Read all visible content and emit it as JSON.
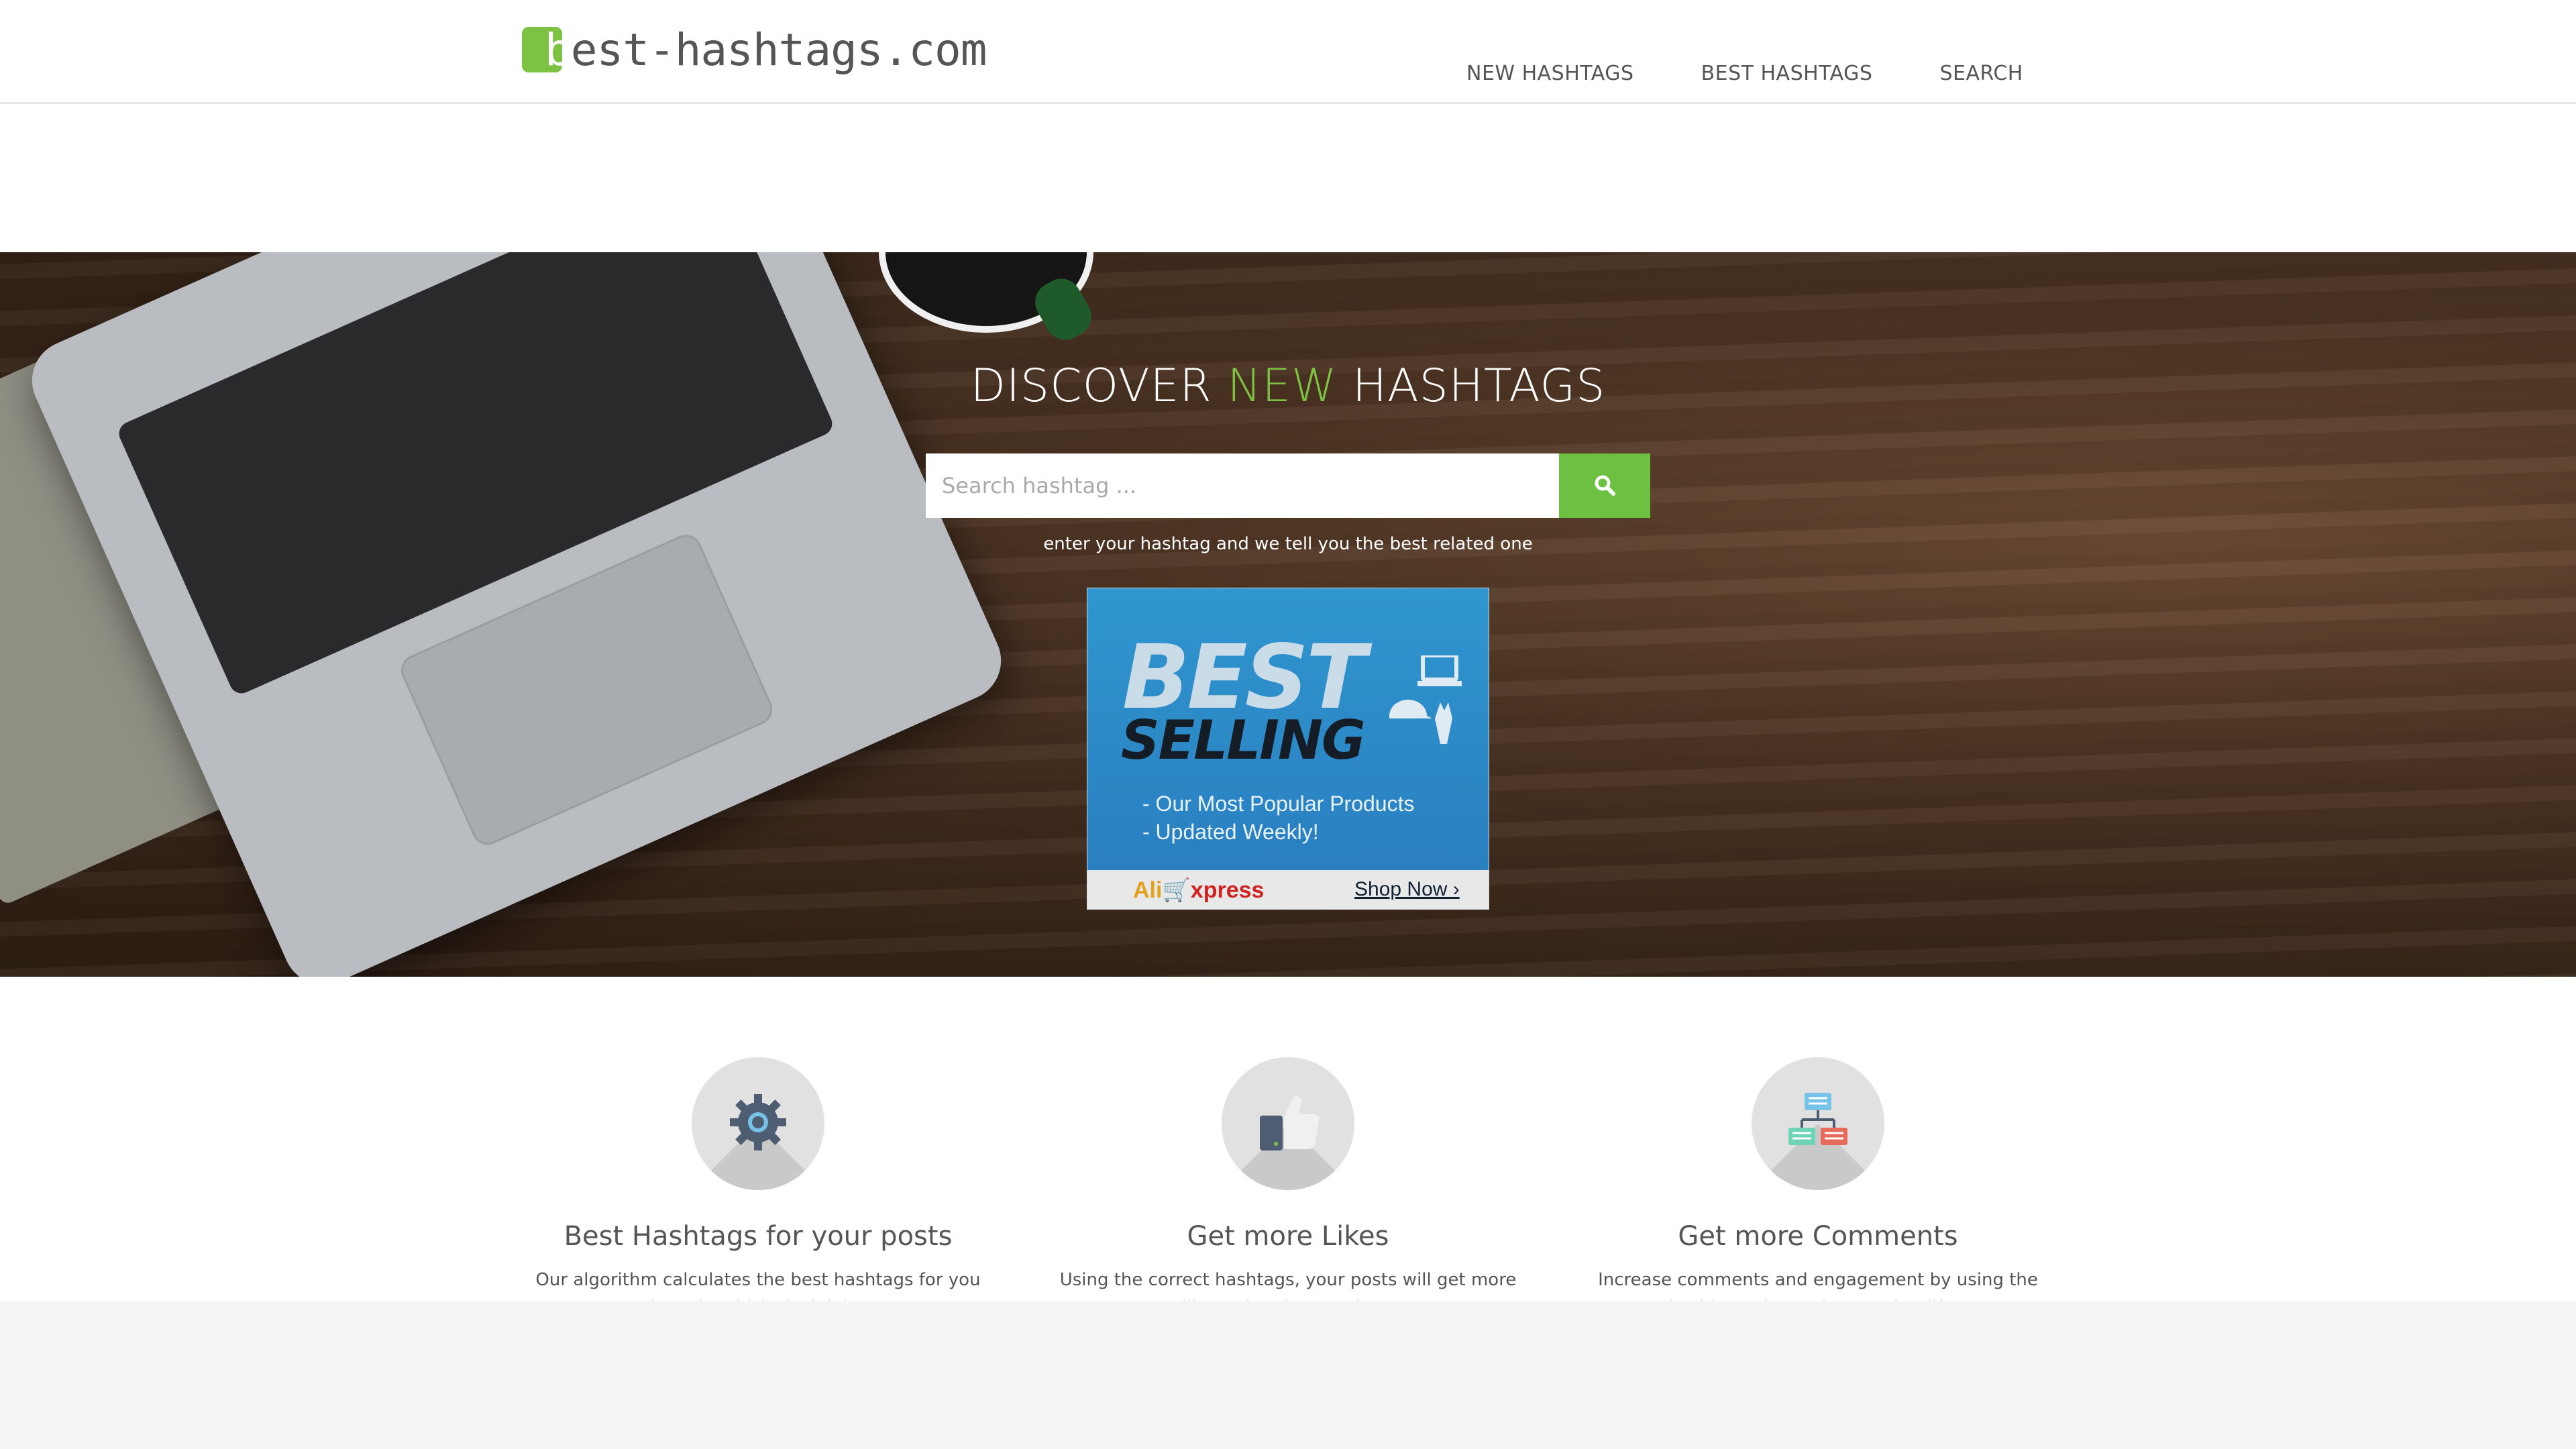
{
  "header": {
    "logo_text": "est-hashtags.com",
    "logo_letter": "b",
    "nav": [
      "NEW HASHTAGS",
      "BEST HASHTAGS",
      "SEARCH"
    ]
  },
  "hero": {
    "title_pre": "DISCOVER ",
    "title_accent": "NEW",
    "title_post": " HASHTAGS",
    "search_placeholder": "Search hashtag ...",
    "subtitle": "enter your hashtag and we tell you the best related one"
  },
  "ad": {
    "line1": "BEST",
    "line2": "SELLING",
    "bullet1": "- Our Most Popular Products",
    "bullet2": "- Updated Weekly!",
    "brand_a": "Ali",
    "brand_b": "xpress",
    "cta": "Shop Now ›"
  },
  "features": [
    {
      "icon": "gear-icon",
      "title": "Best Hashtags for your posts",
      "desc1": "Our algorithm calculates the best hashtags for you",
      "desc2": "based on historical data."
    },
    {
      "icon": "thumbs-up-icon",
      "title": "Get more Likes",
      "desc1": "Using the correct hashtags, your posts will get more",
      "desc2": "like and and more views"
    },
    {
      "icon": "network-icon",
      "title": "Get more Comments",
      "desc1": "Increase comments and engagement by using the",
      "desc2": "hashtags chosen by our algorithm"
    }
  ],
  "colors": {
    "accent": "#7dc242",
    "button": "#6cc042",
    "text": "#555555"
  }
}
